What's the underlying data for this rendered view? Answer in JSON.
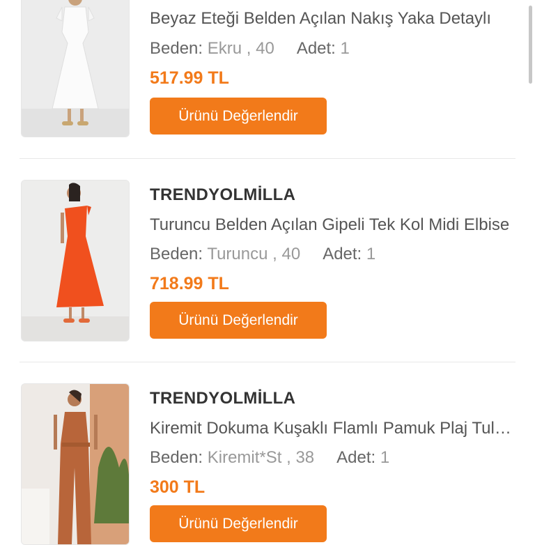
{
  "products": [
    {
      "brand": "",
      "title": "Beyaz Eteği Belden Açılan Nakış Yaka Detaylı",
      "size_label": "Beden:",
      "size_value": "Ekru , 40",
      "qty_label": "Adet:",
      "qty_value": "1",
      "price": "517.99 TL",
      "button": "Ürünü Değerlendir",
      "image_color": "#f4f3ef"
    },
    {
      "brand": "TRENDYOLMİLLA",
      "title": "Turuncu Belden Açılan Gipeli Tek Kol Midi Elbise",
      "size_label": "Beden:",
      "size_value": "Turuncu , 40",
      "qty_label": "Adet:",
      "qty_value": "1",
      "price": "718.99 TL",
      "button": "Ürünü Değerlendir",
      "image_color": "#f0501e"
    },
    {
      "brand": "TRENDYOLMİLLA",
      "title": "Kiremit Dokuma Kuşaklı Flamlı Pamuk Plaj Tulumu",
      "size_label": "Beden:",
      "size_value": "Kiremit*St , 38",
      "qty_label": "Adet:",
      "qty_value": "1",
      "price": "300 TL",
      "button": "Ürünü Değerlendir",
      "image_color": "#b8653a"
    }
  ],
  "colors": {
    "accent": "#f27a1a"
  }
}
